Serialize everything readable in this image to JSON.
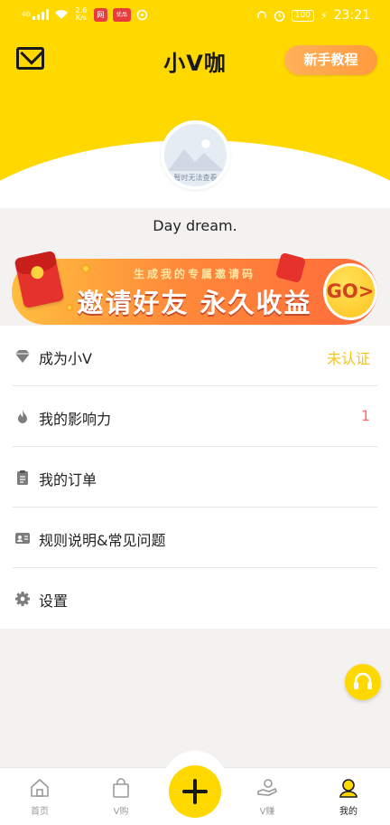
{
  "status_bar": {
    "network_speed": "2.6 K/s",
    "app_icons": [
      "网",
      "优品"
    ],
    "battery": "100",
    "time": "23:21"
  },
  "header": {
    "title": "小V咖",
    "tutorial_label": "新手教程",
    "avatar_placeholder": "暂时无法查看",
    "username": "Day dream."
  },
  "banner": {
    "subtitle": "生成我的专属邀请码",
    "title": "邀请好友 永久收益",
    "go_label": "GO>"
  },
  "menu": [
    {
      "icon": "diamond-icon",
      "label": "成为小V",
      "value": "未认证",
      "value_color": "#f5c518"
    },
    {
      "icon": "flame-icon",
      "label": "我的影响力",
      "value": "1",
      "value_color": "#ff6b6b"
    },
    {
      "icon": "clipboard-icon",
      "label": "我的订单",
      "value": ""
    },
    {
      "icon": "id-card-icon",
      "label": "规则说明&常见问题",
      "value": ""
    },
    {
      "icon": "gear-icon",
      "label": "设置",
      "value": ""
    }
  ],
  "bottom_nav": {
    "items": [
      {
        "icon": "home-icon",
        "label": "首页"
      },
      {
        "icon": "shopping-bag-icon",
        "label": "V购"
      },
      {
        "icon": "plus-icon",
        "label": ""
      },
      {
        "icon": "hand-coin-icon",
        "label": "V赚"
      },
      {
        "icon": "user-icon",
        "label": "我的"
      }
    ],
    "active_index": 4
  },
  "colors": {
    "brand_yellow": "#ffd800",
    "menu_icon": "#7d7d7d"
  }
}
